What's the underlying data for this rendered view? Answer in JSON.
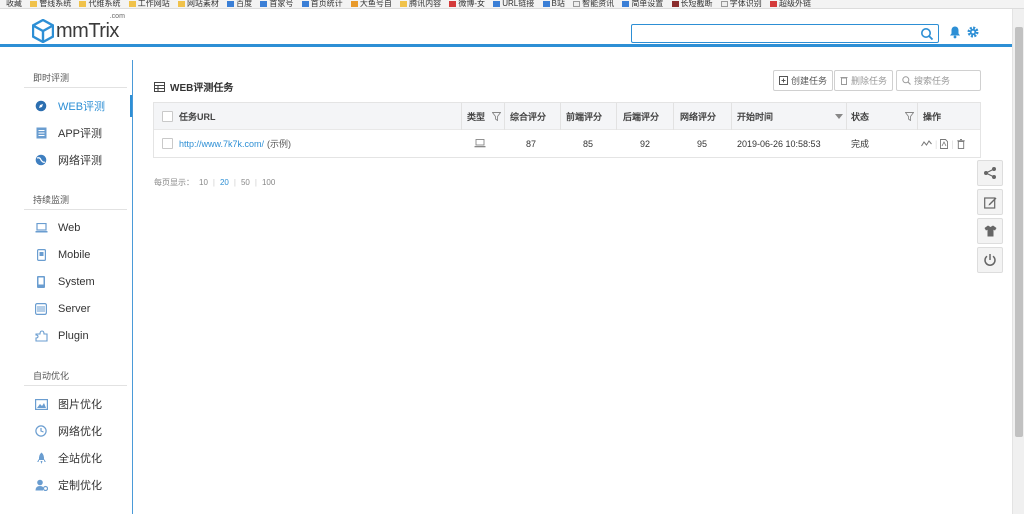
{
  "bookmarks": [
    "收藏",
    "管线系统",
    "代维系统",
    "工作网站",
    "网站素材",
    "百度",
    "首家号",
    "首页统计",
    "大鱼号自",
    "腾讯内容",
    "微博-女",
    "URL链接",
    "B站",
    "智能资讯",
    "简单设置",
    "长短截断",
    "字体识别",
    "超级外链"
  ],
  "header": {
    "logo_text": "mmTrix",
    "logo_sup": ".com",
    "search_value": ""
  },
  "sidebar": {
    "sections": [
      {
        "title": "即时评测",
        "items": [
          {
            "label": "WEB评测",
            "icon": "compass-icon",
            "active": true
          },
          {
            "label": "APP评测",
            "icon": "document-icon"
          },
          {
            "label": "网络评测",
            "icon": "globe-icon"
          }
        ]
      },
      {
        "title": "持续监测",
        "items": [
          {
            "label": "Web",
            "icon": "laptop-icon"
          },
          {
            "label": "Mobile",
            "icon": "mobile-icon"
          },
          {
            "label": "System",
            "icon": "phone-icon"
          },
          {
            "label": "Server",
            "icon": "server-icon"
          },
          {
            "label": "Plugin",
            "icon": "puzzle-icon"
          }
        ]
      },
      {
        "title": "自动优化",
        "items": [
          {
            "label": "图片优化",
            "icon": "image-icon"
          },
          {
            "label": "网络优化",
            "icon": "clock-icon"
          },
          {
            "label": "全站优化",
            "icon": "rocket-icon"
          },
          {
            "label": "定制优化",
            "icon": "user-gear-icon"
          }
        ]
      }
    ]
  },
  "main": {
    "title": "WEB评测任务",
    "create_label": "创建任务",
    "delete_label": "删除任务",
    "search_placeholder": "搜索任务",
    "table": {
      "headers": {
        "url": "任务URL",
        "type": "类型",
        "overall": "综合评分",
        "frontend": "前端评分",
        "backend": "后端评分",
        "network": "网络评分",
        "start": "开始时间",
        "status": "状态",
        "actions": "操作"
      },
      "rows": [
        {
          "url": "http://www.7k7k.com/",
          "note": "(示例)",
          "type_icon": "laptop-icon",
          "overall": "87",
          "frontend": "85",
          "backend": "92",
          "network": "95",
          "start": "2019-06-26 10:58:53",
          "status": "完成"
        }
      ]
    },
    "pager": {
      "label": "每页显示：",
      "options": [
        "10",
        "20",
        "50",
        "100"
      ],
      "selected": "20"
    }
  },
  "float_toolbar": [
    "share-icon",
    "edit-icon",
    "shirt-icon",
    "power-icon"
  ],
  "colors": {
    "accent": "#2d8fd5"
  }
}
